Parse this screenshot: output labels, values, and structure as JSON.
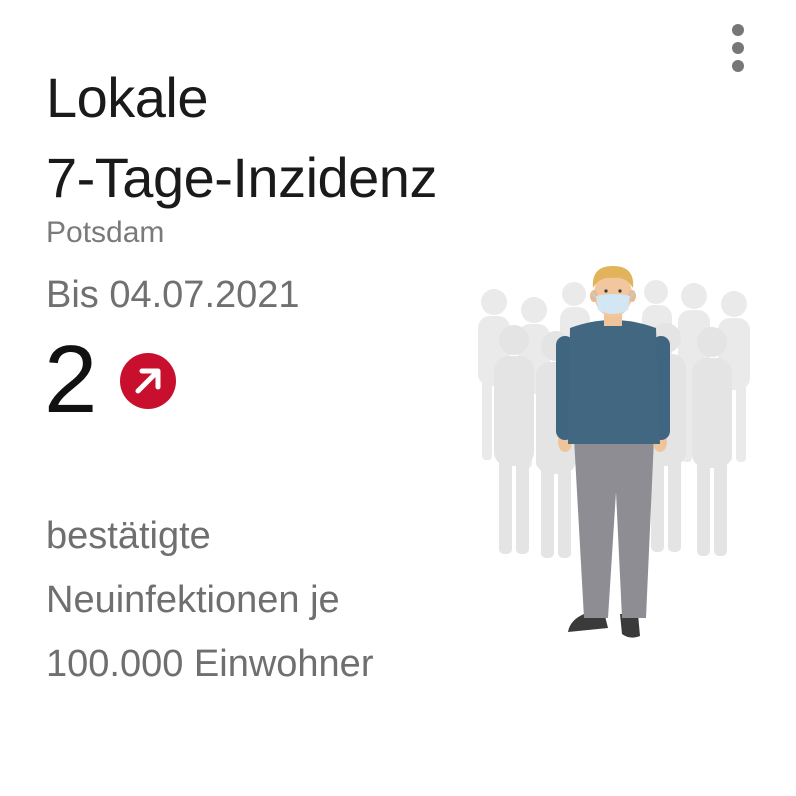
{
  "card": {
    "title_line1": "Lokale",
    "title_line2": "7-Tage-Inzidenz",
    "location": "Potsdam",
    "date": "Bis 04.07.2021",
    "value": "2",
    "trend_icon": "arrow-up-right-icon",
    "description_line1": "bestätigte",
    "description_line2": "Neuinfektionen je",
    "description_line3": "100.000 Einwohner"
  },
  "menu": {
    "icon": "more-vertical-icon"
  },
  "illustration": {
    "icon": "masked-person-crowd-illustration"
  },
  "colors": {
    "trend_badge": "#c8102e",
    "shirt": "#41667f",
    "pants": "#8b8b91",
    "hair": "#e0b25a",
    "mask": "#cfe4f2",
    "crowd": "#e3e3e3",
    "text_primary": "#1a1a1a",
    "text_secondary": "#707070"
  }
}
